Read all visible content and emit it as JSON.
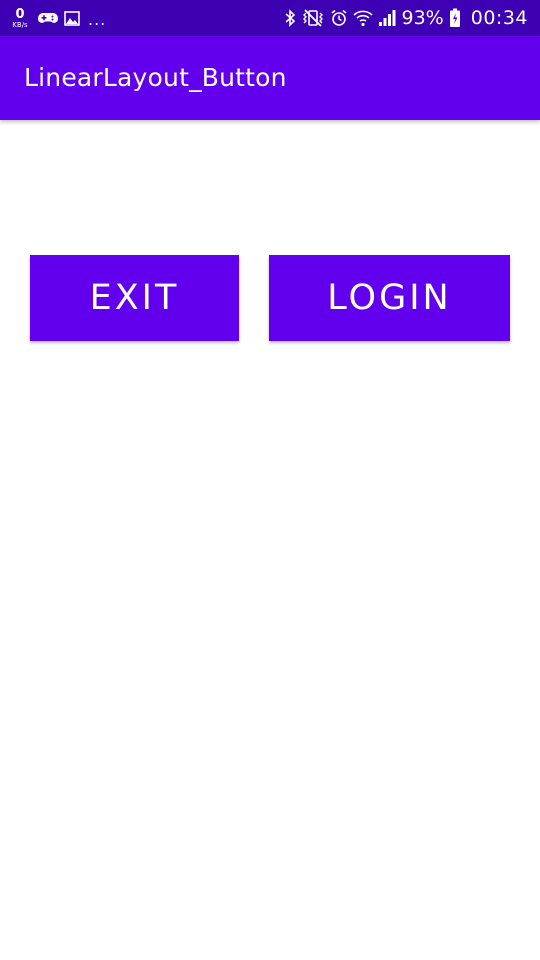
{
  "status_bar": {
    "speed_value": "0",
    "speed_unit": "KB/s",
    "more": "...",
    "battery": "93%",
    "time": "00:34",
    "icons_left": [
      "game-controller-icon",
      "image-icon"
    ],
    "icons_right": [
      "bluetooth-icon",
      "vibrate-icon",
      "alarm-icon",
      "wifi-icon",
      "signal-icon",
      "battery-icon"
    ]
  },
  "app_bar": {
    "title": "LinearLayout_Button",
    "color": "#6200ee"
  },
  "buttons": {
    "exit_label": "EXIT",
    "login_label": "LOGIN",
    "color": "#6200ee"
  }
}
